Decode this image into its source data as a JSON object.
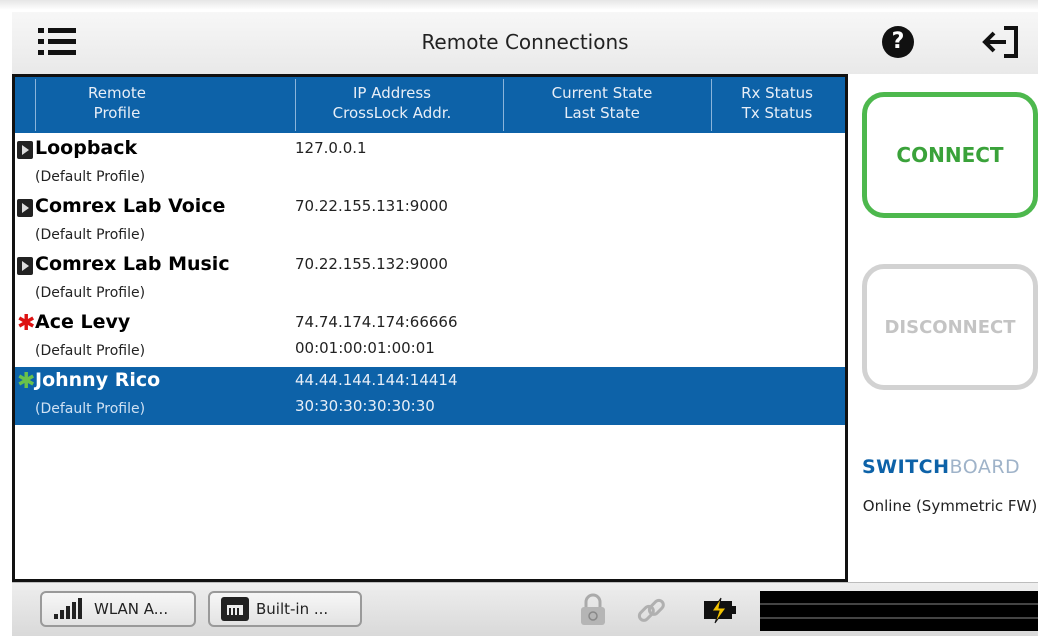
{
  "header": {
    "title": "Remote Connections"
  },
  "columns": [
    {
      "line1": "Remote",
      "line2": "Profile"
    },
    {
      "line1": "IP Address",
      "line2": "CrossLock Addr."
    },
    {
      "line1": "Current State",
      "line2": "Last State"
    },
    {
      "line1": "Rx Status",
      "line2": "Tx Status"
    }
  ],
  "rows": [
    {
      "name": "Loopback",
      "profile": "",
      "ip": "127.0.0.1",
      "crosslock": "",
      "marker": "arrow",
      "selected": false
    },
    {
      "name": "Comrex Lab Voice",
      "profile": "(Default Profile)",
      "ip": "70.22.155.131:9000",
      "crosslock": "",
      "marker": "arrow",
      "selected": false
    },
    {
      "name": "Comrex Lab Music",
      "profile": "(Default Profile)",
      "ip": "70.22.155.132:9000",
      "crosslock": "",
      "marker": "arrow",
      "selected": false
    },
    {
      "name": "Ace Levy",
      "profile": "(Default Profile)",
      "ip": "74.74.174.174:66666",
      "crosslock": "00:01:00:01:00:01",
      "marker": "star-red",
      "selected": false
    },
    {
      "name": "Johnny Rico",
      "profile": "(Default Profile)",
      "ip": "44.44.144.144:14414",
      "crosslock": "30:30:30:30:30:30",
      "marker": "star-green",
      "selected": true
    }
  ],
  "extra_profile": "(Default Profile)",
  "actions": {
    "connect": "CONNECT",
    "disconnect": "DISCONNECT"
  },
  "switchboard": {
    "logo_left": "SWITCH",
    "logo_right": "BOARD",
    "status": "Online (Symmetric FW)"
  },
  "bottom": {
    "wlan_label": "WLAN A...",
    "builtin_label": "Built-in ..."
  },
  "colors": {
    "header_blue": "#0d62a8",
    "connect_green": "#4db84d",
    "disabled_gray": "#d2d2d2"
  },
  "icons": [
    "menu-icon",
    "help-icon",
    "exit-icon",
    "signal-icon",
    "ethernet-icon",
    "lock-icon",
    "link-icon",
    "battery-charging-icon"
  ]
}
